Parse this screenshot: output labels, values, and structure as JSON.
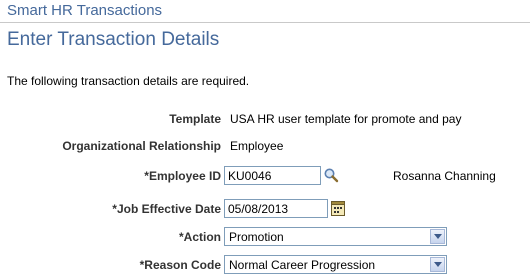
{
  "app": {
    "title": "Smart HR Transactions"
  },
  "page": {
    "title": "Enter Transaction Details",
    "instructions": "The following transaction details are required."
  },
  "form": {
    "template": {
      "label": "Template",
      "value": "USA HR user template for promote and pay"
    },
    "org_relationship": {
      "label": "Organizational Relationship",
      "value": "Employee"
    },
    "employee_id": {
      "label": "*Employee ID",
      "value": "KU0046",
      "name": "Rosanna Channing"
    },
    "job_effective_date": {
      "label": "*Job Effective Date",
      "value": "05/08/2013"
    },
    "action": {
      "label": "*Action",
      "value": "Promotion"
    },
    "reason_code": {
      "label": "*Reason Code",
      "value": "Normal Career Progression"
    }
  },
  "icons": {
    "lookup": "magnifier-icon",
    "calendar": "calendar-icon",
    "dropdown": "chevron-down-icon"
  },
  "colors": {
    "title": "#45699b",
    "border": "#7f9db9"
  }
}
